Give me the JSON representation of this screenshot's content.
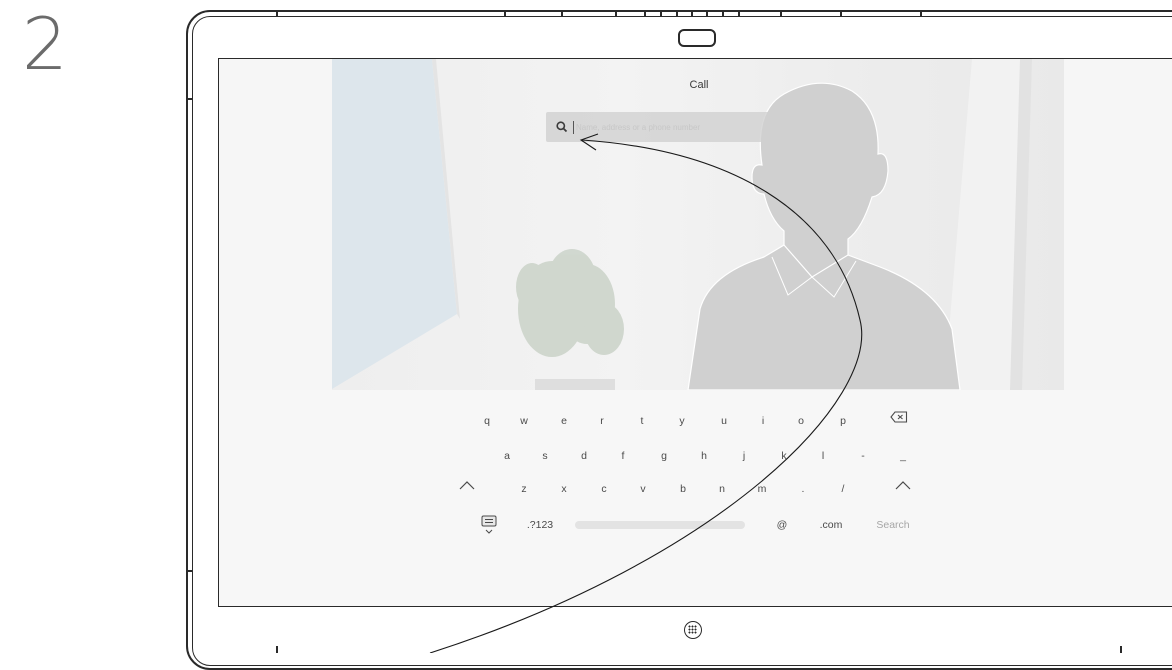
{
  "step": {
    "number": "2"
  },
  "screen": {
    "title": "Call",
    "search": {
      "placeholder": "Name, address or a phone number",
      "value": ""
    }
  },
  "keyboard": {
    "row1": [
      "q",
      "w",
      "e",
      "r",
      "t",
      "y",
      "u",
      "i",
      "o",
      "p"
    ],
    "row2": [
      "a",
      "s",
      "d",
      "f",
      "g",
      "h",
      "j",
      "k",
      "l",
      "-",
      "_"
    ],
    "row3": [
      "z",
      "x",
      "c",
      "v",
      "b",
      "n",
      "m",
      ".",
      "/"
    ],
    "bottom": {
      "numbers_label": ".?123",
      "at_label": "@",
      "dotcom_label": ".com",
      "search_label": "Search"
    }
  },
  "icons": {
    "search": "search-icon",
    "backspace": "backspace-icon",
    "shift": "shift-icon",
    "keyboard_hide": "keyboard-hide-icon",
    "home": "home-grid-icon",
    "camera": "camera-icon"
  },
  "colors": {
    "frame": "#2a2a2a",
    "key_text": "#4a4a4a",
    "arrow": "#1a1a1a"
  }
}
